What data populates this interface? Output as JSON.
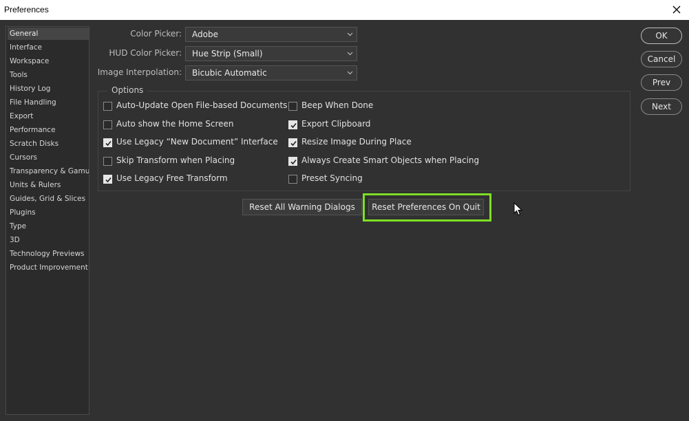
{
  "window": {
    "title": "Preferences"
  },
  "sidebar": {
    "items": [
      {
        "label": "General",
        "active": true
      },
      {
        "label": "Interface"
      },
      {
        "label": "Workspace"
      },
      {
        "label": "Tools"
      },
      {
        "label": "History Log"
      },
      {
        "label": "File Handling"
      },
      {
        "label": "Export"
      },
      {
        "label": "Performance"
      },
      {
        "label": "Scratch Disks"
      },
      {
        "label": "Cursors"
      },
      {
        "label": "Transparency & Gamut"
      },
      {
        "label": "Units & Rulers"
      },
      {
        "label": "Guides, Grid & Slices"
      },
      {
        "label": "Plugins"
      },
      {
        "label": "Type"
      },
      {
        "label": "3D"
      },
      {
        "label": "Technology Previews"
      },
      {
        "label": "Product Improvement"
      }
    ]
  },
  "fields": {
    "color_picker": {
      "label": "Color Picker:",
      "value": "Adobe"
    },
    "hud_color_picker": {
      "label": "HUD Color Picker:",
      "value": "Hue Strip (Small)"
    },
    "image_interpolation": {
      "label": "Image Interpolation:",
      "value": "Bicubic Automatic"
    }
  },
  "options": {
    "title": "Options",
    "left": [
      {
        "label": "Auto-Update Open File-based Documents",
        "checked": false
      },
      {
        "label": "Auto show the Home Screen",
        "checked": false
      },
      {
        "label": "Use Legacy “New Document” Interface",
        "checked": true
      },
      {
        "label": "Skip Transform when Placing",
        "checked": false
      },
      {
        "label": "Use Legacy Free Transform",
        "checked": true
      }
    ],
    "right": [
      {
        "label": "Beep When Done",
        "checked": false
      },
      {
        "label": "Export Clipboard",
        "checked": true
      },
      {
        "label": "Resize Image During Place",
        "checked": true
      },
      {
        "label": "Always Create Smart Objects when Placing",
        "checked": true
      },
      {
        "label": "Preset Syncing",
        "checked": false
      }
    ]
  },
  "buttons": {
    "reset_warnings": "Reset All Warning Dialogs",
    "reset_prefs": "Reset Preferences On Quit",
    "ok": "OK",
    "cancel": "Cancel",
    "prev": "Prev",
    "next": "Next"
  },
  "colors": {
    "highlight": "#7ee024",
    "background": "#313131"
  }
}
